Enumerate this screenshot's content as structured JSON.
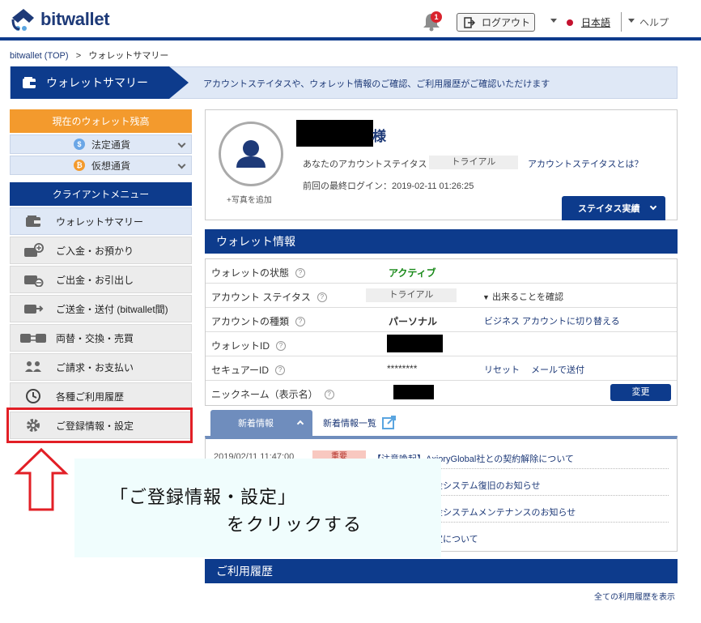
{
  "header": {
    "brand": "bitwallet",
    "notification_count": "1",
    "logout_label": "ログアウト",
    "language": "日本語",
    "help_label": "ヘルプ"
  },
  "breadcrumb": {
    "top": "bitwallet (TOP)",
    "separator": ">",
    "current": "ウォレットサマリー"
  },
  "banner": {
    "title": "ウォレットサマリー",
    "description": "アカウントステイタスや、ウォレット情報のご確認、ご利用履歴がご確認いただけます"
  },
  "sidebar": {
    "balance_title": "現在のウォレット残高",
    "balances": [
      {
        "label": "法定通貨",
        "coin": "$",
        "color": "#6aa6e6"
      },
      {
        "label": "仮想通貨",
        "coin": "₿",
        "color": "#f39a2d"
      }
    ],
    "menu_title": "クライアントメニュー",
    "menu": [
      {
        "label": "ウォレットサマリー",
        "icon": "wallet-icon"
      },
      {
        "label": "ご入金・お預かり",
        "icon": "deposit-icon"
      },
      {
        "label": "ご出金・お引出し",
        "icon": "withdraw-icon"
      },
      {
        "label": "ご送金・送付 (bitwallet間)",
        "icon": "transfer-icon"
      },
      {
        "label": "両替・交換・売買",
        "icon": "exchange-icon"
      },
      {
        "label": "ご請求・お支払い",
        "icon": "billing-icon"
      },
      {
        "label": "各種ご利用履歴",
        "icon": "history-icon"
      },
      {
        "label": "ご登録情報・設定",
        "icon": "gear-icon"
      }
    ]
  },
  "profile": {
    "add_photo": "+写真を追加",
    "honorific": "様",
    "status_label": "あなたのアカウントステイタス",
    "status_value": "トライアル",
    "status_link": "アカウントステイタスとは？",
    "last_login": "前回の最終ログイン：2019-02-11 01:26:25",
    "status_button": "ステイタス実績"
  },
  "wallet_info": {
    "title": "ウォレット情報",
    "rows": {
      "state_label": "ウォレットの状態",
      "state_value": "アクティブ",
      "account_status_label": "アカウント ステイタス",
      "account_status_value": "トライアル",
      "account_status_link": "出来ることを確認",
      "account_type_label": "アカウントの種類",
      "account_type_value": "パーソナル",
      "account_type_link": "ビジネス アカウントに切り替える",
      "wallet_id_label": "ウォレットID",
      "secure_id_label": "セキュアーID",
      "secure_id_value": "********",
      "secure_reset": "リセット",
      "secure_mail": "メールで送付",
      "nickname_label": "ニックネーム（表示名）",
      "change_button": "変更"
    }
  },
  "news": {
    "tab_label": "新着情報",
    "list_link": "新着情報一覧",
    "items": [
      {
        "date": "2019/02/11 11:47:00",
        "tag": "重要",
        "title": "【注意喚起】AxioryGlobal社との契約解除について"
      },
      {
        "title": "金システム復旧のお知らせ"
      },
      {
        "title": "金システムメンテナンスのお知らせ"
      },
      {
        "title": "定について"
      }
    ]
  },
  "history": {
    "title": "ご利用履歴",
    "all_link": "全ての利用履歴を表示"
  },
  "callout": {
    "line1": "「ご登録情報・設定」",
    "line2": "をクリックする"
  },
  "colors": {
    "brand_navy": "#0d3b8c",
    "accent_orange": "#f39a2d",
    "highlight_red": "#e21f26",
    "active_green": "#1a8a1a"
  }
}
